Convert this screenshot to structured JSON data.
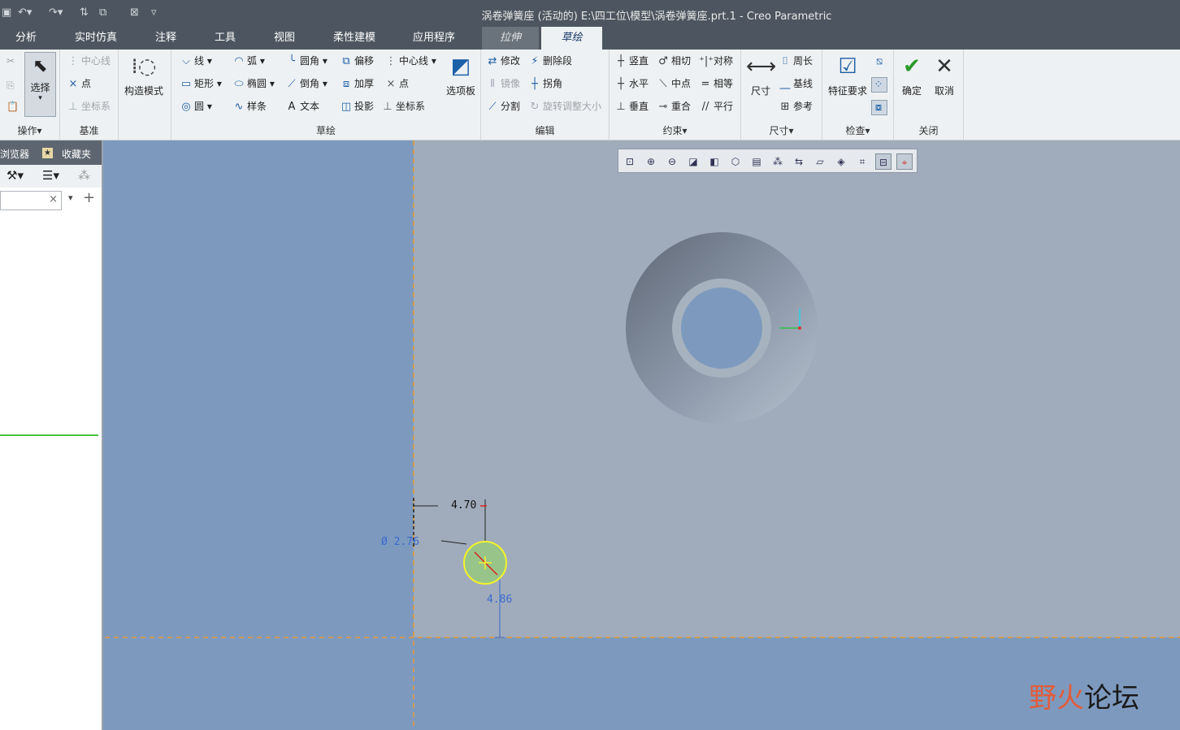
{
  "window": {
    "title": "涡卷弹簧座 (活动的) E:\\四工位\\模型\\涡卷弹簧座.prt.1 - Creo Parametric"
  },
  "menu": {
    "tabs": [
      "分析",
      "实时仿真",
      "注释",
      "工具",
      "视图",
      "柔性建模",
      "应用程序"
    ],
    "context_tab": "拉伸",
    "active_tab": "草绘"
  },
  "ribbon": {
    "operations": {
      "label": "操作",
      "select": "选择"
    },
    "datum": {
      "label": "基准",
      "centerline": "中心线",
      "point": "点",
      "csys": "坐标系"
    },
    "construct_mode": "构造模式",
    "sketch": {
      "label": "草绘",
      "line": "线",
      "rect": "矩形",
      "circle": "圆",
      "arc": "弧",
      "ellipse": "椭圆",
      "spline": "样条",
      "fillet": "圆角",
      "chamfer": "倒角",
      "text": "文本",
      "offset": "偏移",
      "thicken": "加厚",
      "project": "投影",
      "centerline": "中心线",
      "point": "点",
      "csys": "坐标系",
      "palette": "选项板"
    },
    "edit": {
      "label": "编辑",
      "modify": "修改",
      "delete_segment": "删除段",
      "mirror": "镜像",
      "corner": "拐角",
      "divide": "分割",
      "rotate_resize": "旋转调整大小"
    },
    "constrain": {
      "label": "约束",
      "vertical": "竖直",
      "tangent": "相切",
      "symmetric": "对称",
      "horizontal": "水平",
      "midpoint": "中点",
      "equal": "相等",
      "perpendicular": "垂直",
      "coincident": "重合",
      "parallel": "平行"
    },
    "dimension": {
      "label": "尺寸",
      "dim": "尺寸",
      "perimeter": "周长",
      "baseline": "基线",
      "reference": "参考"
    },
    "inspect": {
      "label": "检查",
      "feature_req": "特征要求"
    },
    "close": {
      "label": "关闭",
      "ok": "确定",
      "cancel": "取消"
    }
  },
  "left_panel": {
    "tab_browser": "浏览器",
    "tab_favorites": "收藏夹"
  },
  "sketch": {
    "dim_horizontal": "4.70",
    "dim_diameter": "Ø 2.76",
    "dim_vertical": "4.86"
  },
  "watermark": {
    "text1": "野火",
    "text2": "论坛"
  },
  "colors": {
    "titlebar": "#4d5660",
    "ribbon": "#eef1f3",
    "canvas": "#7d9abe",
    "sketch_plane": "#a0acbb",
    "accent_blue": "#1d5fa8"
  }
}
